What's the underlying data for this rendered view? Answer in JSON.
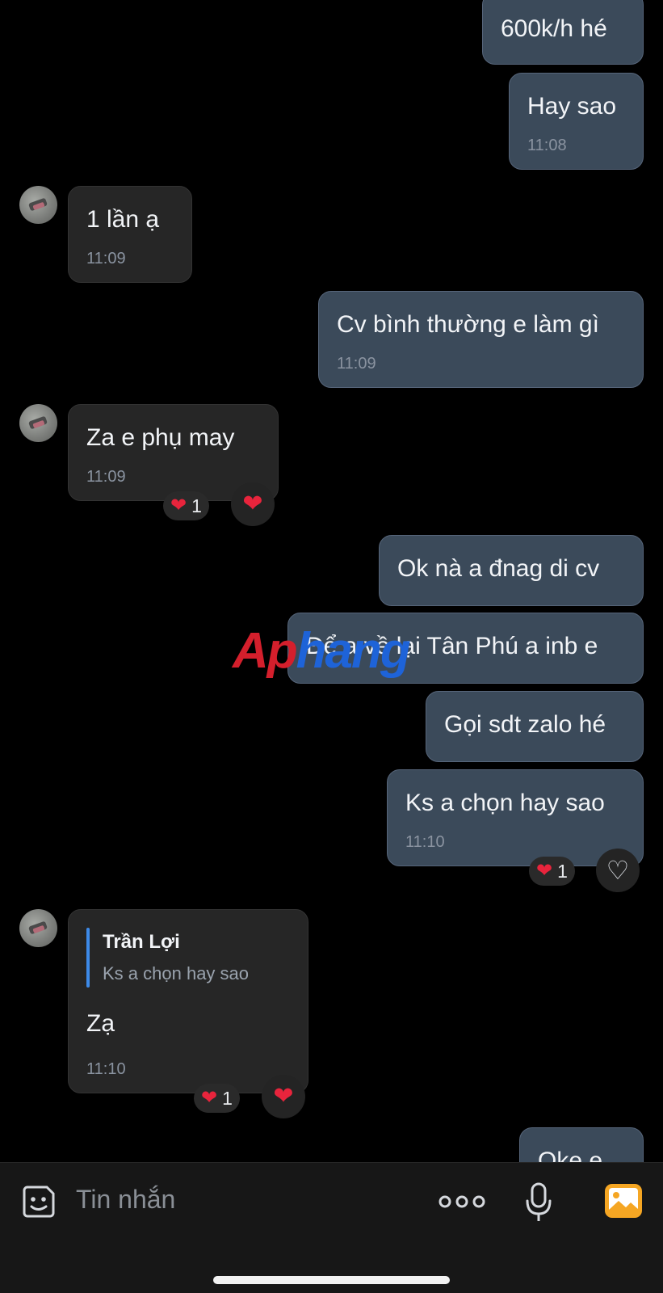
{
  "messages": [
    {
      "id": "m1",
      "text": "600k/h hé",
      "time": ""
    },
    {
      "id": "m2",
      "text": "Hay sao",
      "time": "11:08"
    },
    {
      "id": "m3",
      "text": "1 lần ạ",
      "time": "11:09"
    },
    {
      "id": "m4",
      "text": "Cv bình thường e làm gì",
      "time": "11:09"
    },
    {
      "id": "m5",
      "text": "Za e phụ may",
      "time": "11:09",
      "reaction_count": "1"
    },
    {
      "id": "m6",
      "text": "Ok nà a đnag di cv",
      "time": ""
    },
    {
      "id": "m7",
      "text": "Để a về lại Tân Phú a inb e",
      "time": ""
    },
    {
      "id": "m8",
      "text": "Gọi sdt zalo hé",
      "time": ""
    },
    {
      "id": "m9",
      "text": "Ks a chọn hay sao",
      "time": "11:10",
      "reaction_count": "1"
    },
    {
      "id": "m10",
      "text": "Zạ",
      "time": "11:10",
      "reaction_count": "1",
      "quote": {
        "name": "Trần Lợi",
        "text": "Ks a chọn hay sao"
      }
    },
    {
      "id": "m11",
      "text": "Oke e",
      "time": ""
    }
  ],
  "composer": {
    "placeholder": "Tin nhắn"
  },
  "watermark": {
    "part1": "Ap",
    "part2": "hang"
  },
  "colors": {
    "outgoing": "#3b4a5a",
    "incoming": "#262626",
    "heart": "#e8243c",
    "quote_bar": "#3d8ae8",
    "photo_icon": "#f5a623"
  },
  "icons": [
    "sticker-icon",
    "more-icon",
    "microphone-icon",
    "photo-icon",
    "heart-icon"
  ]
}
